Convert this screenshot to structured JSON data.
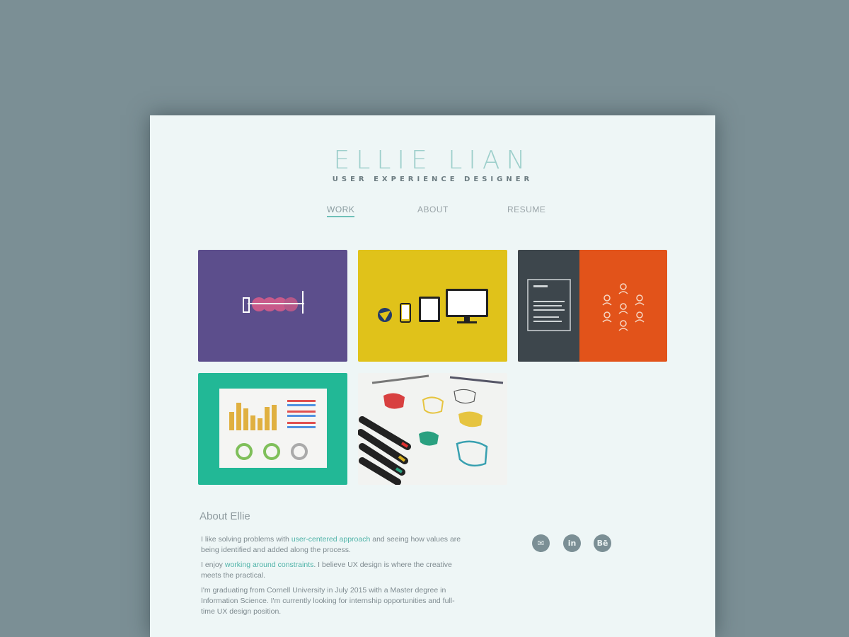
{
  "header": {
    "name": "ELLIE LIAN",
    "tagline": "USER EXPERIENCE DESIGNER"
  },
  "nav": {
    "items": [
      "WORK",
      "ABOUT",
      "RESUME"
    ],
    "active": "WORK"
  },
  "portfolio": {
    "tile_colors": [
      "#5c4e8c",
      "#e0c21a",
      "#e2531a",
      "#22b896",
      "#f4f4f2"
    ]
  },
  "about": {
    "title": "About Ellie",
    "p1_before": "I like solving problems with ",
    "p1_link": "user-centered approach",
    "p1_after": " and seeing how values are being identified and added along the process.",
    "p2_before": "I enjoy ",
    "p2_link": "working around constraints",
    "p2_after": ". I believe UX design is where the creative meets the practical.",
    "p3": "I'm graduating from Cornell University in July 2015 with a Master degree in Information Science. I'm currently looking for internship opportunities and full-time UX design position."
  },
  "social": {
    "icons": [
      "email-icon",
      "linkedin-icon",
      "behance-icon"
    ],
    "glyphs": [
      "✉",
      "in",
      "Bē"
    ]
  },
  "colors": {
    "background": "#7b8f95",
    "page": "#eef6f6",
    "accent": "#6fc0b8"
  }
}
